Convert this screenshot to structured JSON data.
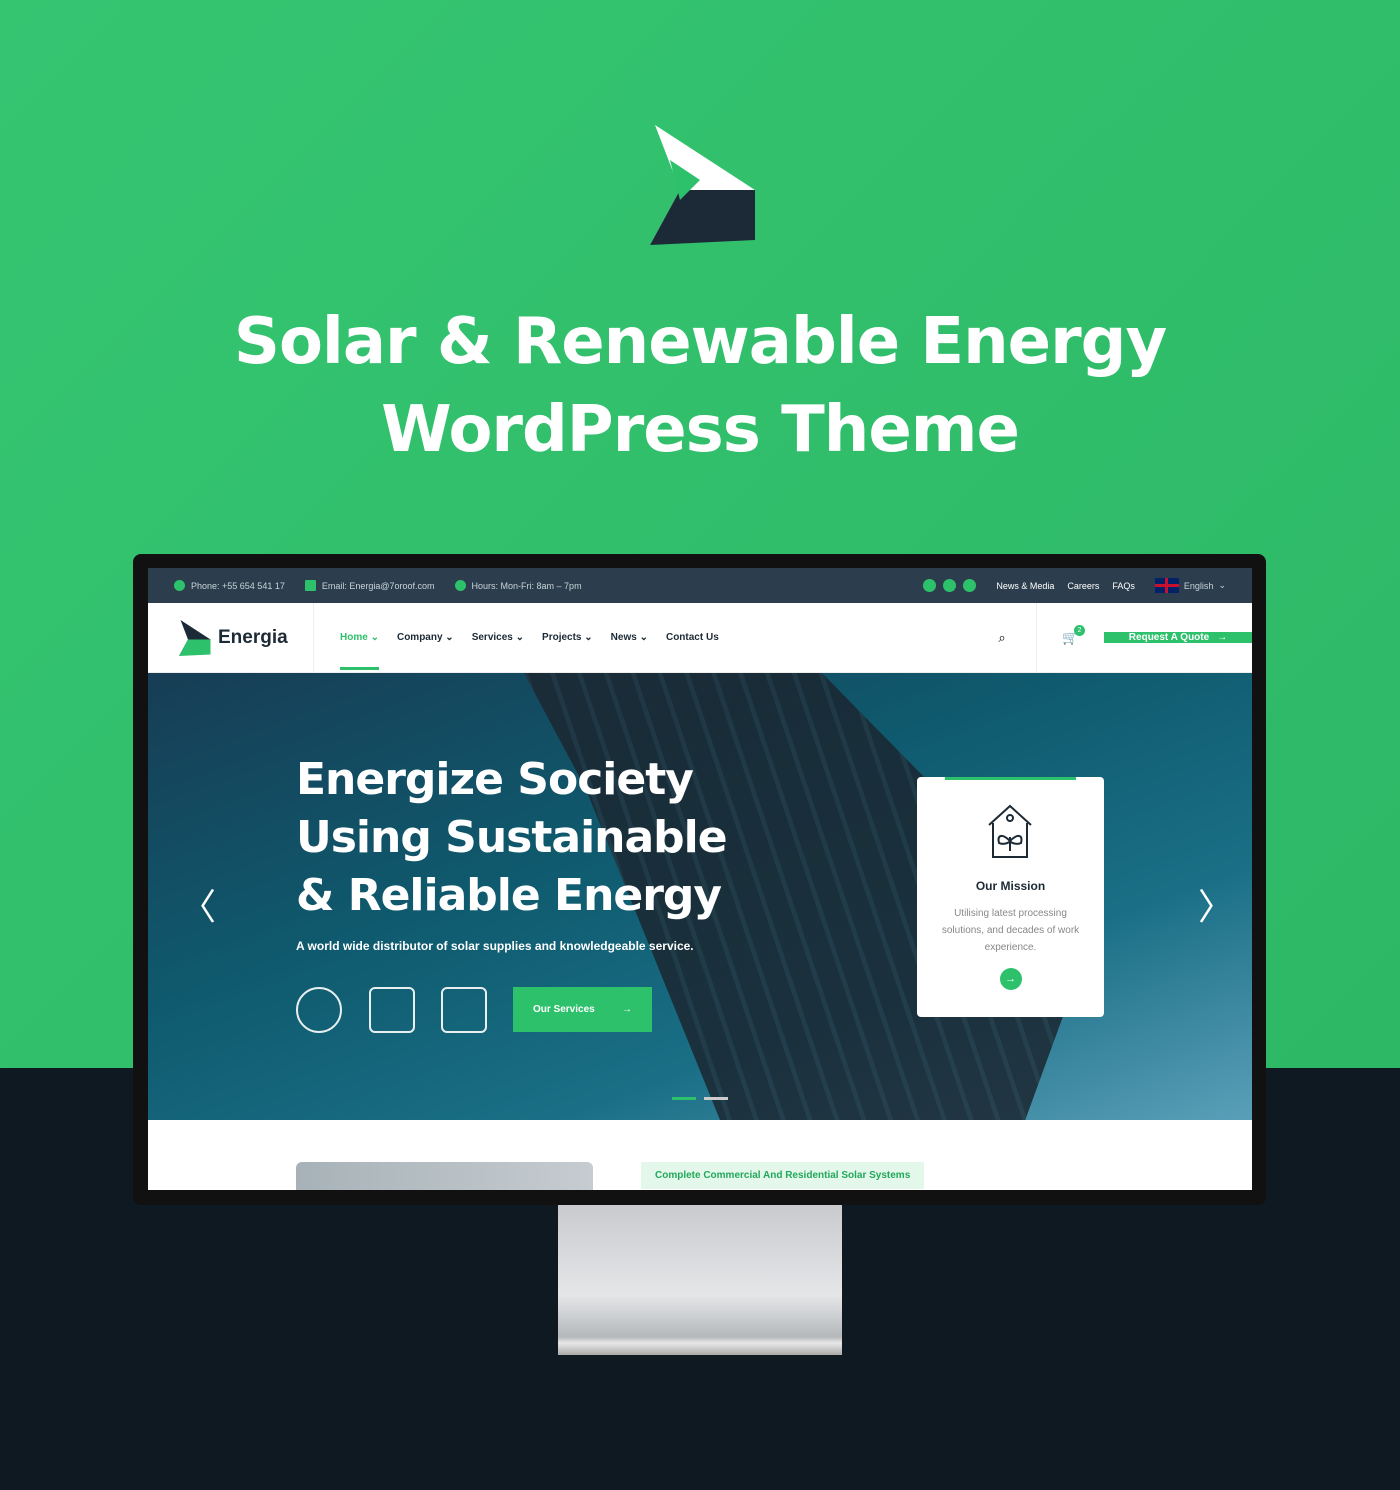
{
  "hero_banner": {
    "title_line1": "Solar & Renewable Energy",
    "title_line2": "WordPress Theme"
  },
  "topbar": {
    "phone": "Phone: +55 654 541 17",
    "email": "Email: Energia@7oroof.com",
    "hours": "Hours: Mon-Fri: 8am – 7pm",
    "links": [
      "News & Media",
      "Careers",
      "FAQs"
    ],
    "language": "English"
  },
  "nav": {
    "brand": "Energia",
    "items": [
      "Home",
      "Company",
      "Services",
      "Projects",
      "News",
      "Contact Us"
    ],
    "cart_count": "2",
    "quote": "Request A Quote"
  },
  "hero": {
    "title": [
      "Energize Society",
      "Using Sustainable",
      "& Reliable Energy"
    ],
    "subtitle": "A world wide distributor of solar supplies and knowledgeable service.",
    "button": "Our Services"
  },
  "card": {
    "title": "Our Mission",
    "text": "Utilising latest processing solutions, and decades of work experience."
  },
  "below": {
    "tag": "Complete Commercial And Residential Solar Systems"
  },
  "colors": {
    "accent": "#2ec16c",
    "topbar": "#2c3e4d",
    "dark": "#0f1922"
  }
}
